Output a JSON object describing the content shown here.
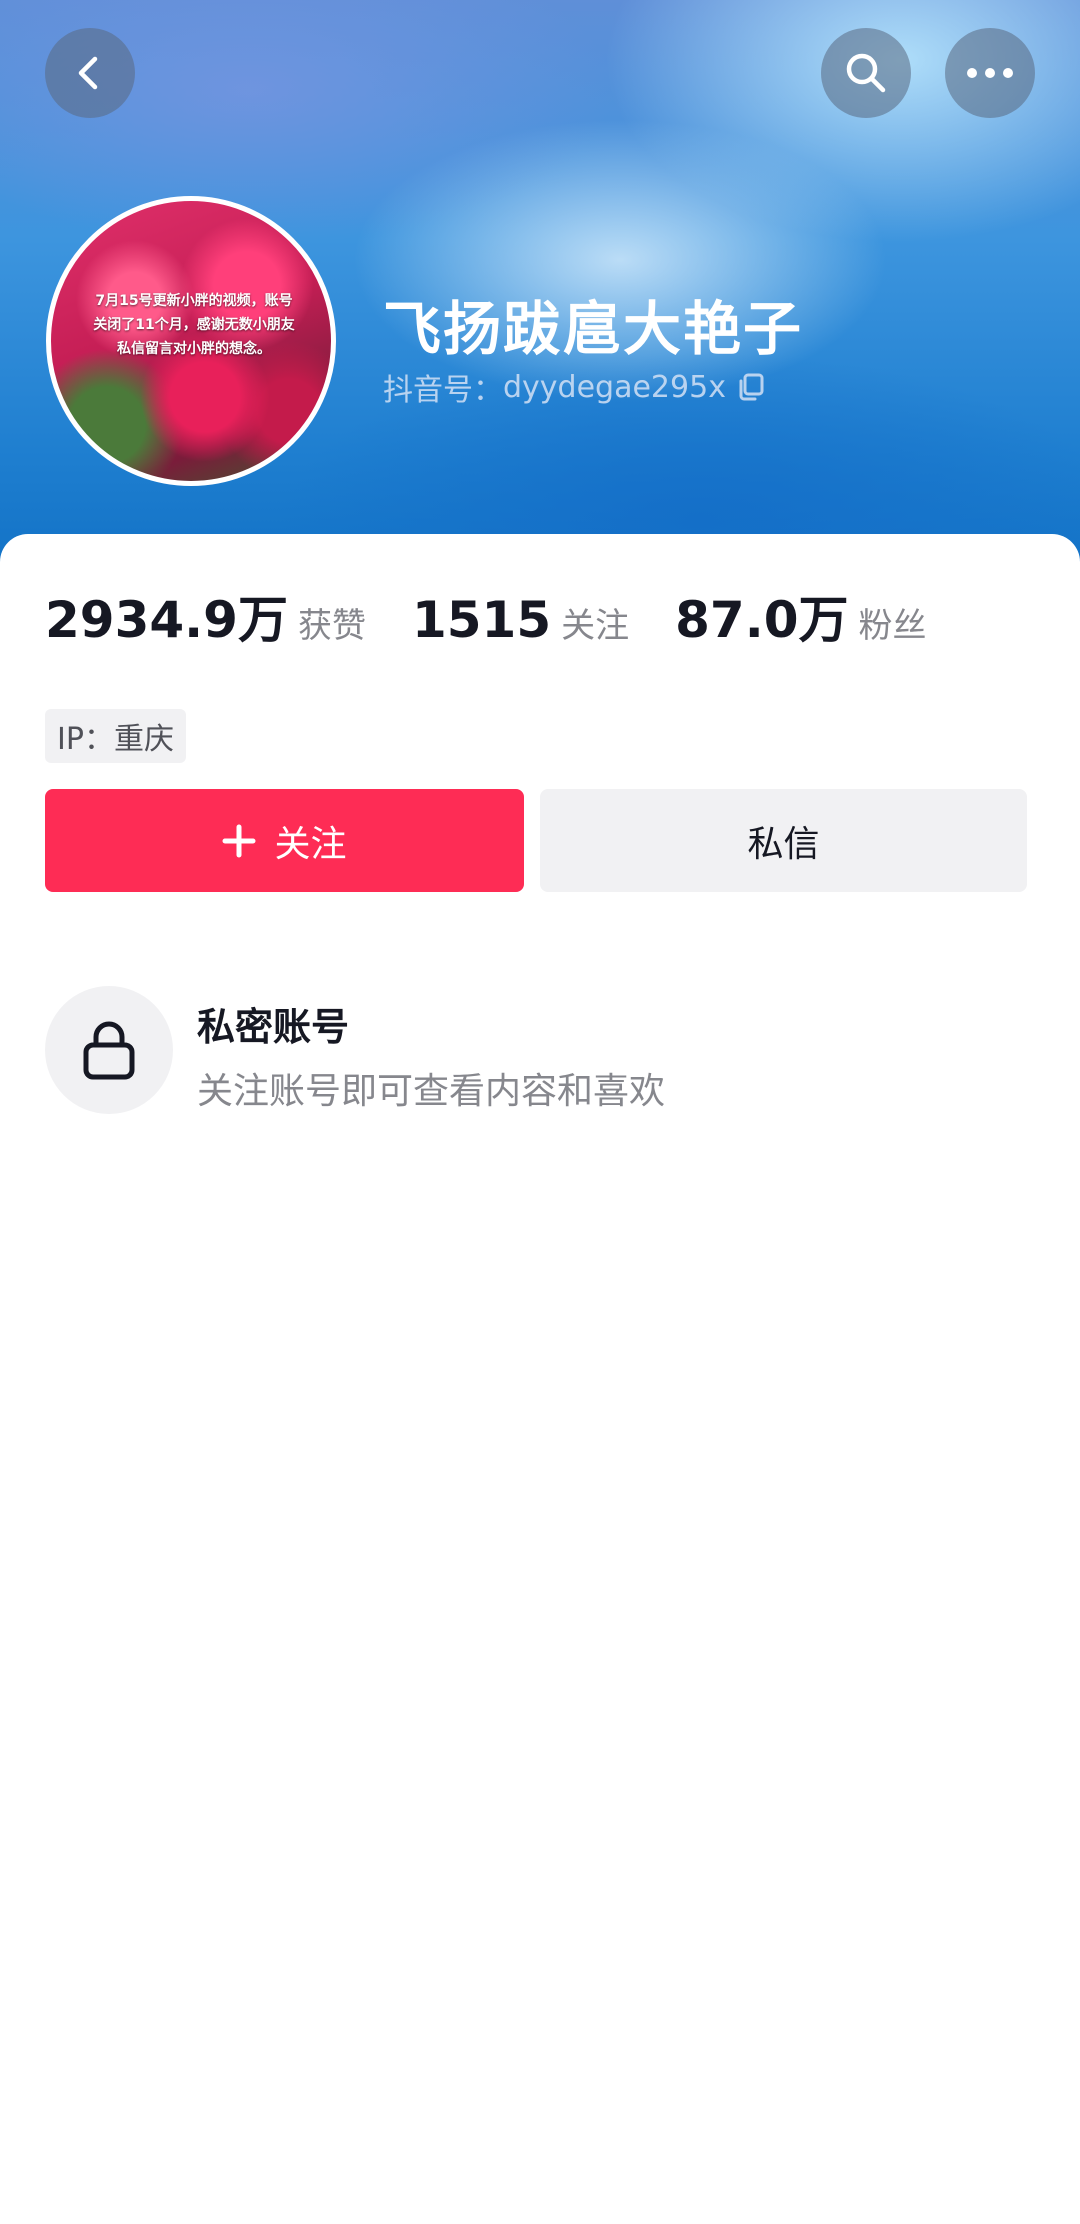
{
  "profile": {
    "username": "飞扬跋扈大艳子",
    "douyin_id_label": "抖音号：",
    "douyin_id": "dyydegae295x",
    "ip_label": "IP：重庆",
    "avatar_caption": "7月15号更新小胖的视频，账号\n关闭了11个月，感谢无数小朋友\n私信留言对小胖的想念。"
  },
  "stats": [
    {
      "value": "2934.9万",
      "label": "获赞"
    },
    {
      "value": "1515",
      "label": "关注"
    },
    {
      "value": "87.0万",
      "label": "粉丝"
    }
  ],
  "actions": {
    "follow_label": "关注",
    "message_label": "私信"
  },
  "private_notice": {
    "title": "私密账号",
    "description": "关注账号即可查看内容和喜欢"
  },
  "colors": {
    "accent": "#fe2c55",
    "text_primary": "#161823",
    "text_secondary": "#86878d",
    "button_gray": "#f1f1f3"
  },
  "icons": {
    "back": "chevron-left-icon",
    "search": "search-icon",
    "more": "more-dots-icon",
    "copy": "copy-icon",
    "plus": "plus-icon",
    "lock": "lock-icon"
  }
}
